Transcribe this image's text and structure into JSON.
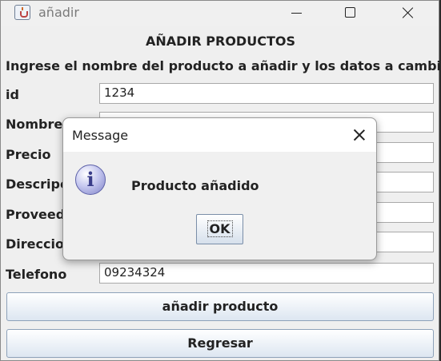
{
  "window": {
    "title": "añadir"
  },
  "form": {
    "heading": "AÑADIR  PRODUCTOS",
    "instructions": "Ingrese el nombre del producto a añadir y los datos a cambiar",
    "fields": [
      {
        "label": "id",
        "value": "1234"
      },
      {
        "label": "Nombre",
        "value": ""
      },
      {
        "label": "Precio",
        "value": ""
      },
      {
        "label": "Descripcion",
        "value": ""
      },
      {
        "label": "Proveedor",
        "value": ""
      },
      {
        "label": "Direccion",
        "value": ""
      },
      {
        "label": "Telefono",
        "value": "09234324"
      }
    ],
    "add_button": "añadir producto",
    "back_button": "Regresar"
  },
  "dialog": {
    "title": "Message",
    "icon": "information-icon",
    "message": "Producto añadido",
    "ok_label": "OK"
  }
}
